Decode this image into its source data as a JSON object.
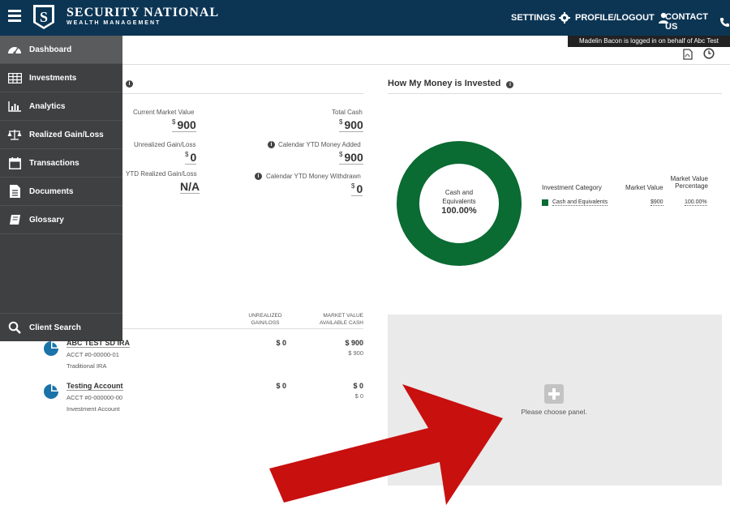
{
  "header": {
    "brand_name": "SECURITY NATIONAL",
    "brand_sub": "WEALTH MANAGEMENT",
    "settings_label": "SETTINGS",
    "profile_label": "PROFILE/LOGOUT",
    "contact_label": "CONTACT US",
    "impersonation_note": "Madelin Bacon is logged in on behalf of Abc Test"
  },
  "sidebar": {
    "items": [
      {
        "label": "Dashboard",
        "icon": "dashboard-icon"
      },
      {
        "label": "Investments",
        "icon": "table-icon"
      },
      {
        "label": "Analytics",
        "icon": "bar-chart-icon"
      },
      {
        "label": "Realized Gain/Loss",
        "icon": "scale-icon"
      },
      {
        "label": "Transactions",
        "icon": "calendar-icon"
      },
      {
        "label": "Documents",
        "icon": "document-icon"
      },
      {
        "label": "Glossary",
        "icon": "book-icon"
      }
    ],
    "client_search": "Client Search"
  },
  "summary": {
    "current_market_value_label": "Current Market Value",
    "current_market_value": "900",
    "unrealized_label": "Unrealized Gain/Loss",
    "unrealized": "0",
    "ytd_realized_label": "YTD Realized Gain/Loss",
    "ytd_realized": "N/A",
    "total_cash_label": "Total Cash",
    "total_cash": "900",
    "ytd_added_label": "Calendar YTD Money Added",
    "ytd_added": "900",
    "ytd_withdrawn_label": "Calendar YTD Money Withdrawn",
    "ytd_withdrawn": "0",
    "currency": "$"
  },
  "invested": {
    "title": "How My Money is Invested",
    "donut_label_line1": "Cash and",
    "donut_label_line2": "Equivalents",
    "donut_pct": "100.00%",
    "col_category": "Investment Category",
    "col_market_value": "Market Value",
    "col_mv_pct_line1": "Market Value",
    "col_mv_pct_line2": "Percentage",
    "rows": [
      {
        "category": "Cash and Equivalents",
        "market_value": "$900",
        "percentage": "100.00%",
        "color": "#0a6b33"
      }
    ]
  },
  "accounts": {
    "col_unrealized_line1": "UNREALIZED",
    "col_unrealized_line2": "GAIN/LOSS",
    "col_mv_line1": "MARKET VALUE",
    "col_mv_line2": "AVAILABLE CASH",
    "rows": [
      {
        "name": "ABC TEST SD IRA",
        "acct": "ACCT #0-00000-01",
        "type": "Traditional IRA",
        "unrealized": "$ 0",
        "market_value": "$ 900",
        "cash": "$ 900"
      },
      {
        "name": "Testing Account",
        "acct": "ACCT #0-000000-00",
        "type": "Investment Account",
        "unrealized": "$ 0",
        "market_value": "$ 0",
        "cash": "$ 0"
      }
    ]
  },
  "panel": {
    "prompt": "Please choose panel."
  },
  "colors": {
    "header_bg": "#0c3554",
    "sidebar_bg": "#3f4042",
    "donut_green": "#0a6b33",
    "arrow_red": "#c8100f"
  }
}
